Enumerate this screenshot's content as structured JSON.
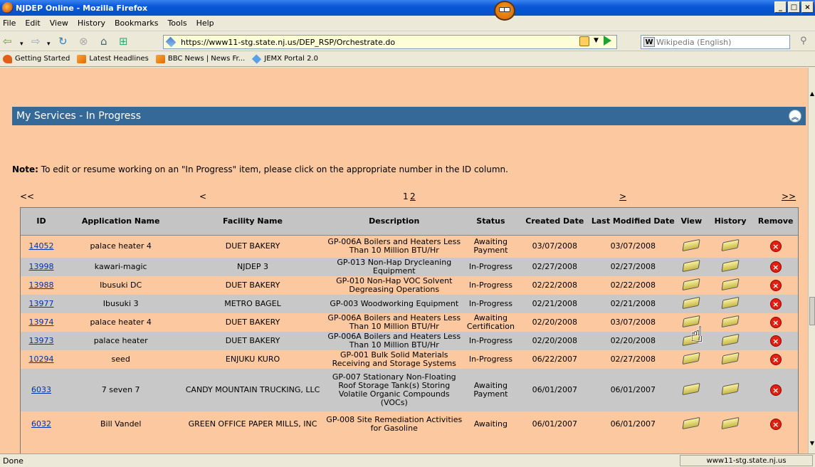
{
  "window": {
    "title": "NJDEP Online - Mozilla Firefox"
  },
  "menu": [
    "File",
    "Edit",
    "View",
    "History",
    "Bookmarks",
    "Tools",
    "Help"
  ],
  "nav": {
    "url": "https://www11-stg.state.nj.us/DEP_RSP/Orchestrate.do",
    "search_placeholder": "Wikipedia (English)",
    "search_engine_icon": "W"
  },
  "bookmarks": [
    "Getting Started",
    "Latest Headlines",
    "BBC News | News Fr...",
    "JEMX Portal 2.0"
  ],
  "panel": {
    "title": "My Services - In Progress"
  },
  "note": {
    "label": "Note:",
    "text": " To edit or resume working on an \"In Progress\" item, please click on the appropriate number in the ID column."
  },
  "pager": {
    "first": "<<",
    "prev": "<",
    "page1": "1",
    "page2": "2",
    "next": ">",
    "last": ">>"
  },
  "columns": {
    "id": "ID",
    "app": "Application Name",
    "facility": "Facility Name",
    "desc": "Description",
    "status": "Status",
    "created": "Created Date",
    "modified": "Last Modified Date",
    "view": "View",
    "history": "History",
    "remove": "Remove"
  },
  "rows": [
    {
      "id": "14052",
      "app": "palace heater 4",
      "facility": "DUET BAKERY",
      "desc": "GP-006A Boilers and Heaters Less Than 10 Million BTU/Hr",
      "status": "Awaiting Payment",
      "created": "03/07/2008",
      "modified": "03/07/2008"
    },
    {
      "id": "13998",
      "app": "kawari-magic",
      "facility": "NJDEP 3",
      "desc": "GP-013 Non-Hap Drycleaning Equipment",
      "status": "In-Progress",
      "created": "02/27/2008",
      "modified": "02/27/2008"
    },
    {
      "id": "13988",
      "app": "Ibusuki DC",
      "facility": "DUET BAKERY",
      "desc": "GP-010 Non-Hap VOC Solvent Degreasing Operations",
      "status": "In-Progress",
      "created": "02/22/2008",
      "modified": "02/22/2008"
    },
    {
      "id": "13977",
      "app": "Ibusuki 3",
      "facility": "METRO BAGEL",
      "desc": "GP-003 Woodworking Equipment",
      "status": "In-Progress",
      "created": "02/21/2008",
      "modified": "02/21/2008"
    },
    {
      "id": "13974",
      "app": "palace heater 4",
      "facility": "DUET BAKERY",
      "desc": "GP-006A Boilers and Heaters Less Than 10 Million BTU/Hr",
      "status": "Awaiting Certification",
      "created": "02/20/2008",
      "modified": "03/07/2008"
    },
    {
      "id": "13973",
      "app": "palace heater",
      "facility": "DUET BAKERY",
      "desc": "GP-006A Boilers and Heaters Less Than 10 Million BTU/Hr",
      "status": "In-Progress",
      "created": "02/20/2008",
      "modified": "02/20/2008"
    },
    {
      "id": "10294",
      "app": "seed",
      "facility": "ENJUKU KURO",
      "desc": "GP-001 Bulk Solid Materials Receiving and Storage Systems",
      "status": "In-Progress",
      "created": "06/22/2007",
      "modified": "02/27/2008"
    },
    {
      "id": "6033",
      "app": "7 seven 7",
      "facility": "CANDY MOUNTAIN TRUCKING, LLC",
      "desc": "GP-007 Stationary Non-Floating Roof Storage Tank(s) Storing Volatile Organic Compounds (VOCs)",
      "status": "Awaiting Payment",
      "created": "06/01/2007",
      "modified": "06/01/2007"
    },
    {
      "id": "6032",
      "app": "Bill Vandel",
      "facility": "GREEN OFFICE PAPER MILLS, INC",
      "desc": "GP-008 Site Remediation Activities for Gasoline",
      "status": "Awaiting",
      "created": "06/01/2007",
      "modified": "06/01/2007"
    }
  ],
  "status": {
    "left": "Done",
    "host": "www11-stg.state.nj.us"
  },
  "colors": {
    "page_bg": "#fcc8a0",
    "panel_header": "#356a98",
    "row_alt": "#c8c8c8",
    "link": "#0033a0"
  }
}
